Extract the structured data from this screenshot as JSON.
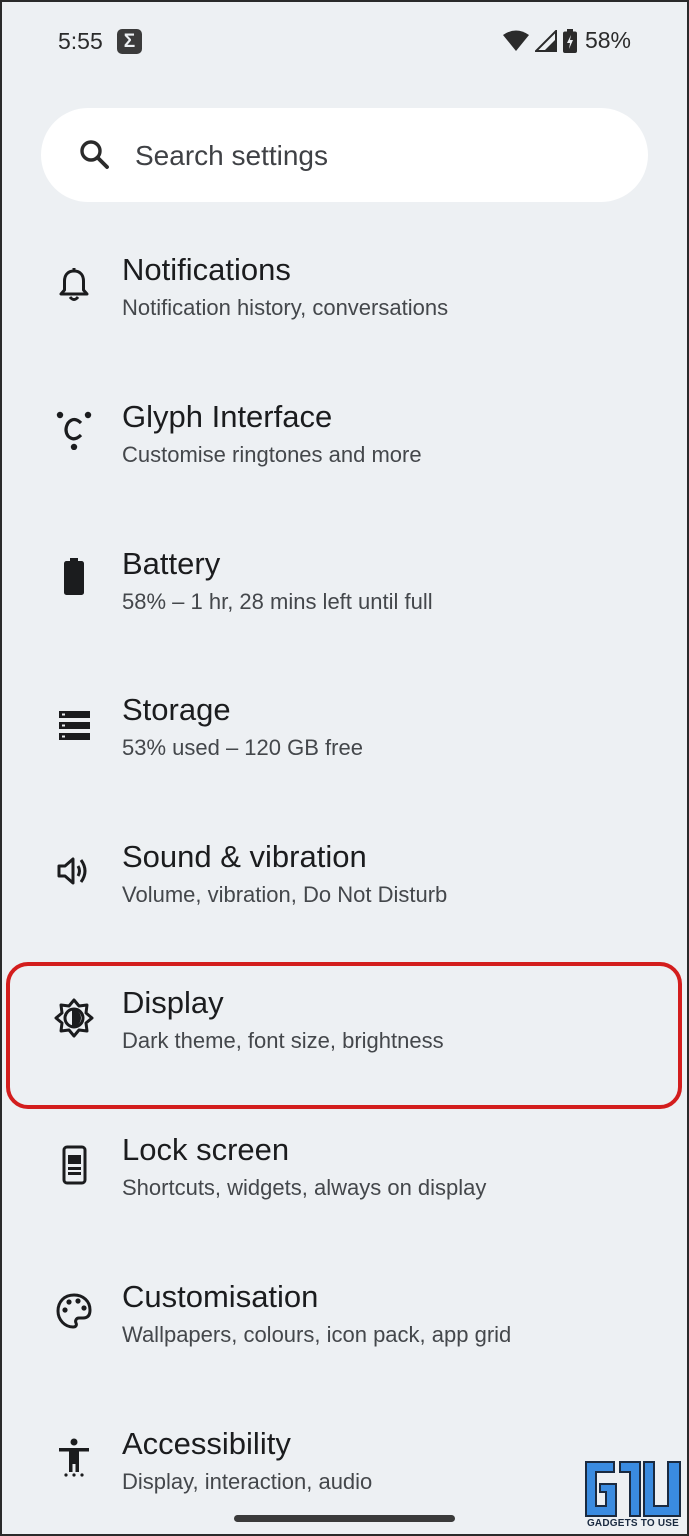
{
  "status_bar": {
    "time": "5:55",
    "app_icon": "sigma-icon",
    "battery_percent": "58%",
    "icons": [
      "wifi-icon",
      "cellular-signal-icon",
      "battery-charging-icon"
    ]
  },
  "search": {
    "placeholder": "Search settings",
    "icon": "search-icon"
  },
  "settings": {
    "items": [
      {
        "title": "Notifications",
        "summary": "Notification history, conversations",
        "icon": "bell-icon"
      },
      {
        "title": "Glyph Interface",
        "summary": "Customise ringtones and more",
        "icon": "glyph-icon"
      },
      {
        "title": "Battery",
        "summary": "58% – 1 hr, 28 mins left until full",
        "icon": "battery-icon"
      },
      {
        "title": "Storage",
        "summary": "53% used – 120 GB free",
        "icon": "storage-icon"
      },
      {
        "title": "Sound & vibration",
        "summary": "Volume, vibration, Do Not Disturb",
        "icon": "volume-icon"
      },
      {
        "title": "Display",
        "summary": "Dark theme, font size, brightness",
        "icon": "brightness-icon"
      },
      {
        "title": "Lock screen",
        "summary": "Shortcuts, widgets, always on display",
        "icon": "phone-lock-icon"
      },
      {
        "title": "Customisation",
        "summary": "Wallpapers, colours, icon pack, app grid",
        "icon": "palette-icon"
      },
      {
        "title": "Accessibility",
        "summary": "Display, interaction, audio",
        "icon": "accessibility-icon"
      }
    ]
  },
  "highlight": {
    "color": "#d31d1d",
    "item": "Display"
  },
  "watermark": {
    "text": "GADGETS TO USE"
  },
  "colors": {
    "background": "#edf0f3",
    "search_background": "#ffffff",
    "highlight": "#d31d1d"
  }
}
